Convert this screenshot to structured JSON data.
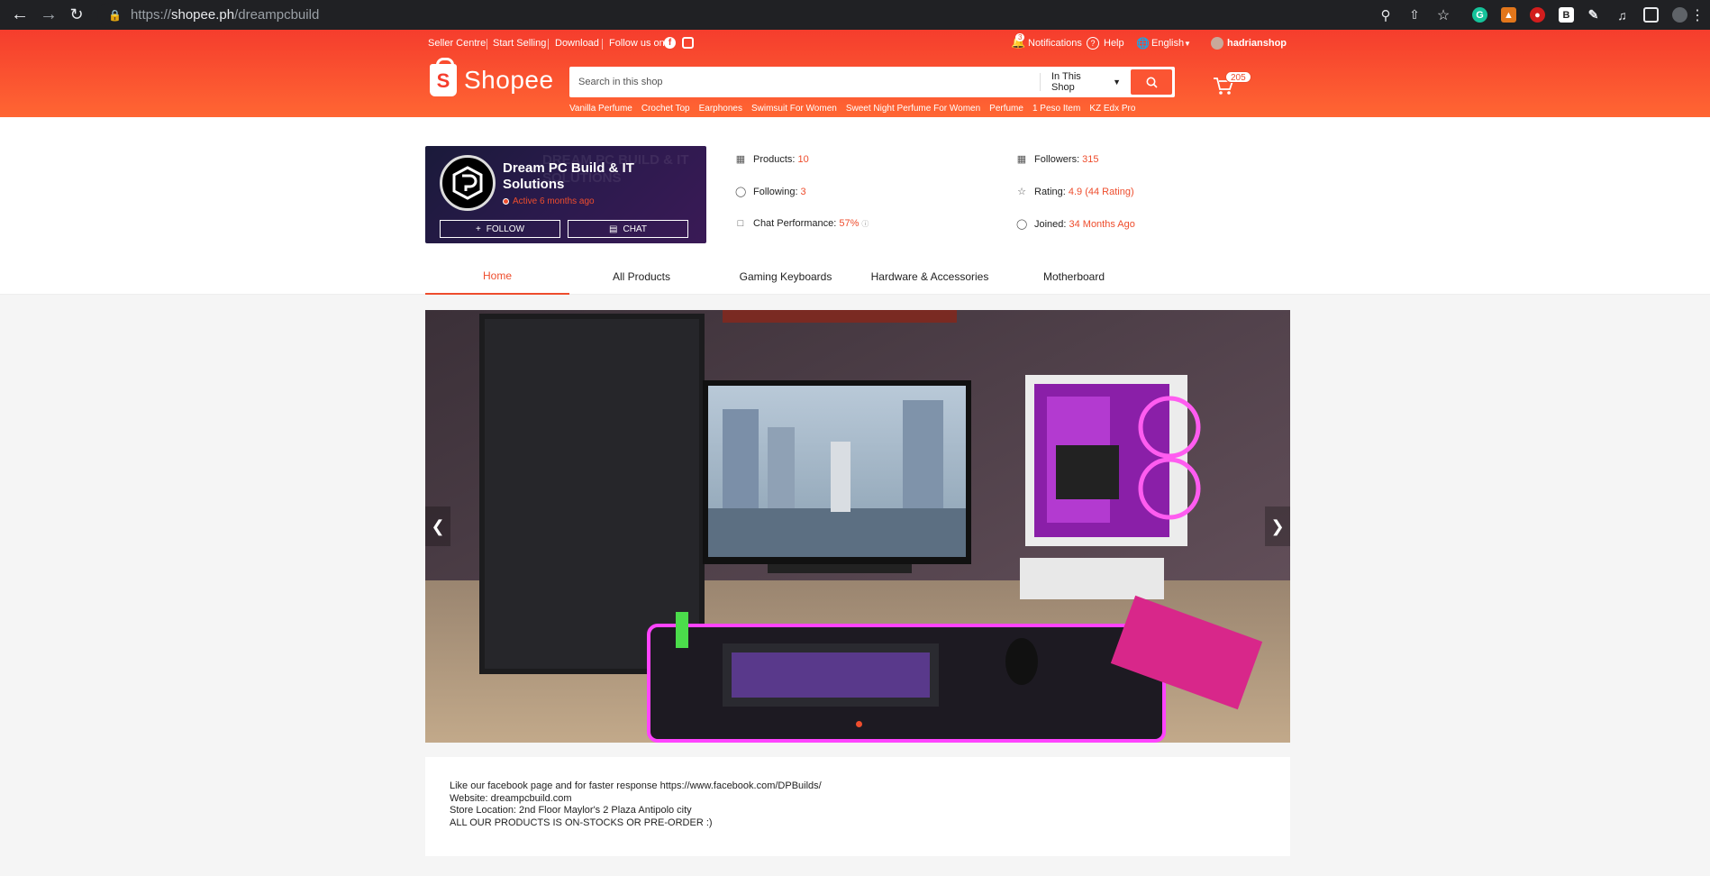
{
  "browser": {
    "url_prefix": "https://",
    "url_host": "shopee.ph",
    "url_path": "/dreampcbuild"
  },
  "topbar": {
    "seller_centre": "Seller Centre",
    "start_selling": "Start Selling",
    "download": "Download",
    "follow_us": "Follow us on",
    "notifications_count": "3",
    "notifications": "Notifications",
    "help": "Help",
    "language": "English",
    "username": "hadrianshop"
  },
  "header": {
    "logo_text": "Shopee",
    "search_placeholder": "Search in this shop",
    "search_scope": "In This Shop",
    "cart_count": "205",
    "keywords": [
      "Vanilla Perfume",
      "Crochet Top",
      "Earphones",
      "Swimsuit For Women",
      "Sweet Night Perfume For Women",
      "Perfume",
      "1 Peso Item",
      "KZ Edx Pro"
    ]
  },
  "shop": {
    "name": "Dream PC Build & IT Solutions",
    "active": "Active 6 months ago",
    "follow": "FOLLOW",
    "chat": "CHAT",
    "watermark": "DREAM PC BUILD & IT SOLUTIONS"
  },
  "stats": {
    "products_label": "Products:",
    "products_value": "10",
    "following_label": "Following:",
    "following_value": "3",
    "chat_label": "Chat Performance:",
    "chat_value": "57%",
    "followers_label": "Followers:",
    "followers_value": "315",
    "rating_label": "Rating:",
    "rating_value": "4.9 (44 Rating)",
    "joined_label": "Joined:",
    "joined_value": "34 Months Ago"
  },
  "tabs": [
    "Home",
    "All Products",
    "Gaming Keyboards",
    "Hardware & Accessories",
    "Motherboard"
  ],
  "description": [
    "Like our facebook page and for faster response https://www.facebook.com/DPBuilds/",
    "Website: dreampcbuild.com",
    "Store Location: 2nd Floor Maylor's 2 Plaza Antipolo city",
    "ALL OUR PRODUCTS IS ON-STOCKS OR PRE-ORDER :)"
  ],
  "colors": {
    "brand": "#ee4d2d",
    "header_gradient_start": "#f53d2d",
    "header_gradient_end": "#ff6633"
  }
}
